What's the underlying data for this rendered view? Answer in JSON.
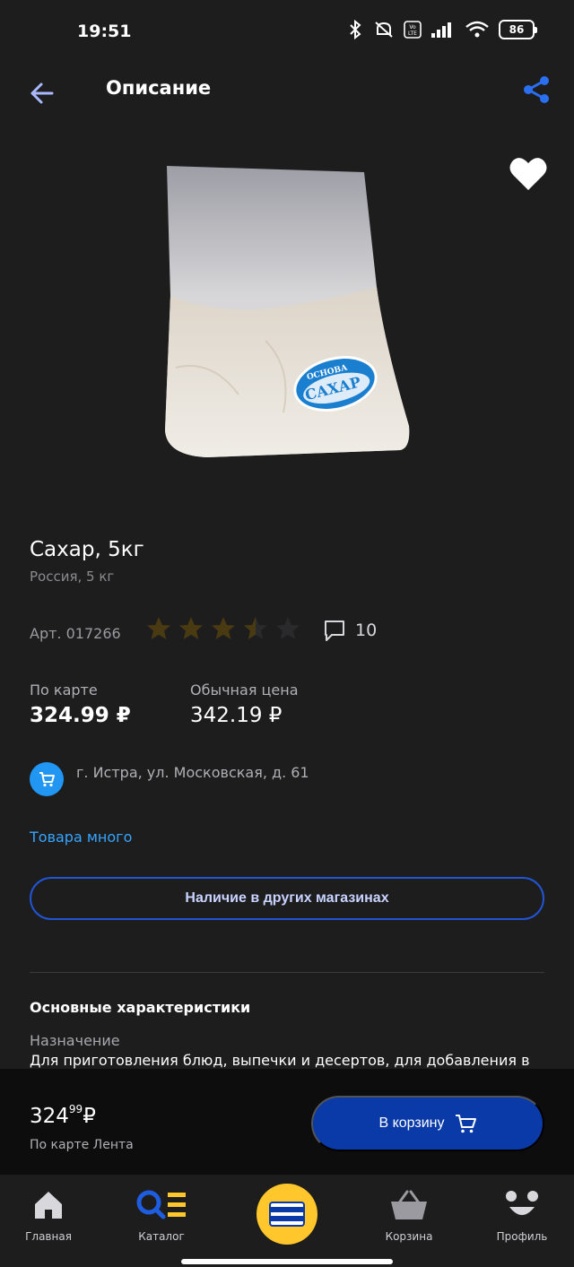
{
  "status_bar": {
    "time": "19:51",
    "battery": "86"
  },
  "header": {
    "title": "Описание"
  },
  "product": {
    "title": "Сахар, 5кг",
    "subtitle": "Россия, 5 кг",
    "article": "Арт. 017266",
    "rating": 3.5,
    "rating_max": 5,
    "review_count": "10"
  },
  "prices": {
    "card_label": "По карте",
    "card_price": "324.99 ₽",
    "regular_label": "Обычная цена",
    "regular_price": "342.19 ₽"
  },
  "store": {
    "address": "г. Истра, ул. Московская, д. 61",
    "stock_status": "Товара много",
    "other_stores_button": "Наличие в других магазинах"
  },
  "specs": {
    "heading": "Основные характеристики",
    "purpose_label": "Назначение",
    "purpose_value": "Для приготовления блюд, выпечки и десертов, для добавления в"
  },
  "buy_bar": {
    "price_main": "324",
    "price_cents": "99",
    "currency": "₽",
    "price_note": "По карте Лента",
    "cart_button": "В корзину"
  },
  "bottom_nav": {
    "items": [
      {
        "label": "Главная",
        "icon": "home-icon"
      },
      {
        "label": "Каталог",
        "icon": "catalog-icon"
      },
      {
        "label": "",
        "icon": "loyalty-card-icon"
      },
      {
        "label": "Корзина",
        "icon": "basket-icon"
      },
      {
        "label": "Профиль",
        "icon": "profile-icon"
      }
    ]
  },
  "colors": {
    "background": "#1d1d1e",
    "accent_blue": "#35a5ff",
    "button_blue": "#0a3aa7",
    "star": "#4a3a12",
    "card_yellow": "#ffc72c"
  },
  "package_label": {
    "brand": "ОСНОВА",
    "name": "САХАР"
  }
}
